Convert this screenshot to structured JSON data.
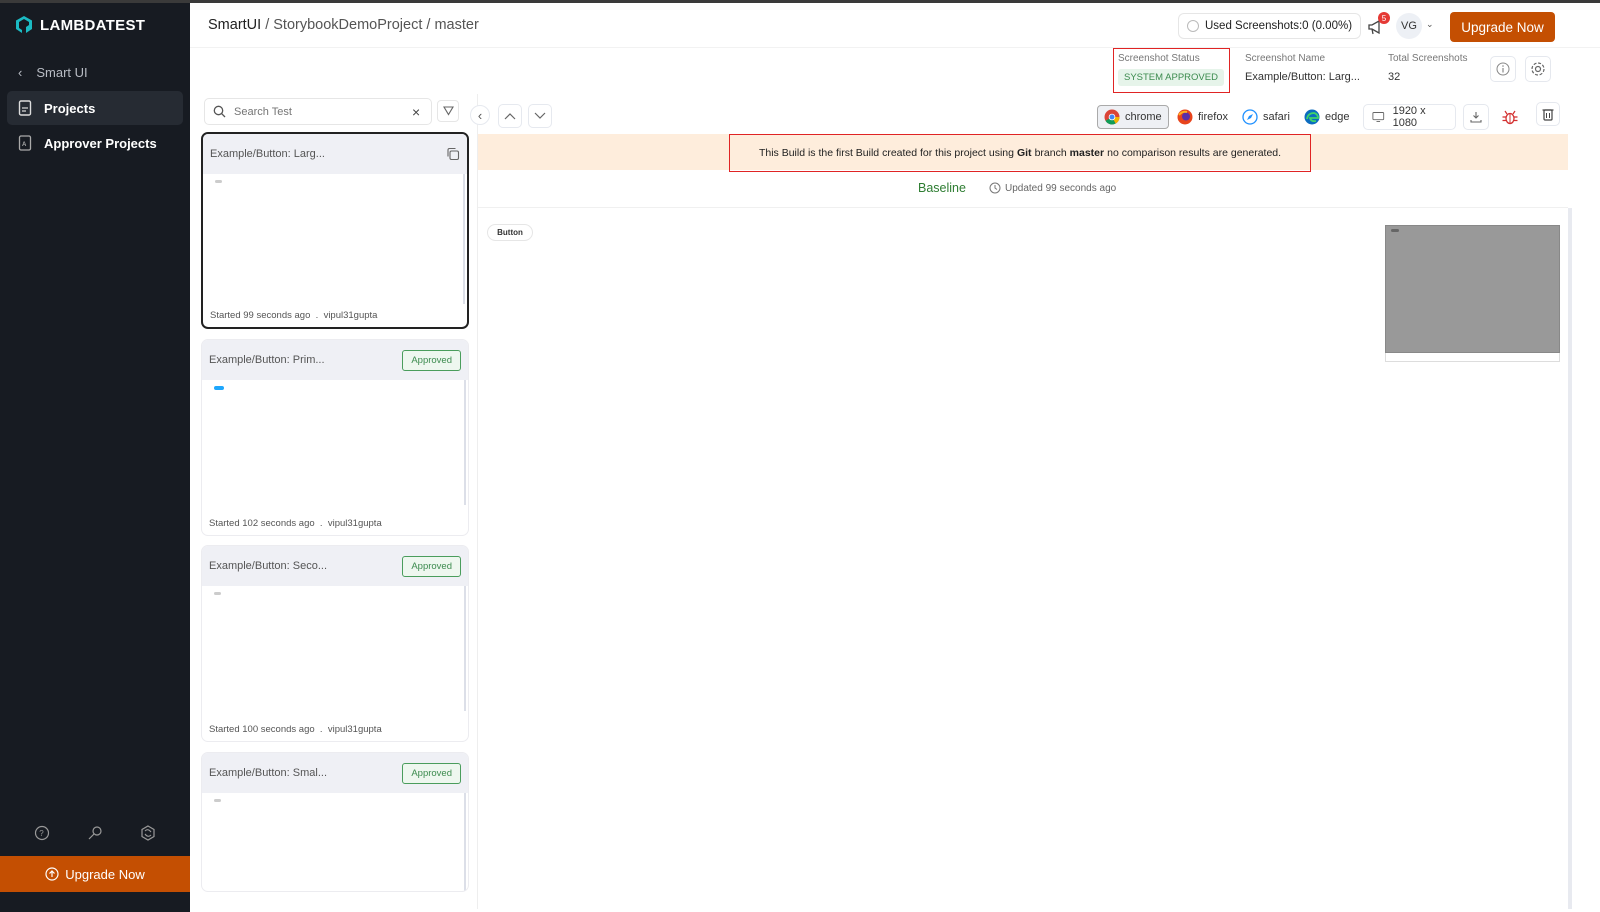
{
  "sidebar": {
    "brand": "LAMBDATEST",
    "back_label": "Smart UI",
    "items": [
      {
        "label": "Projects",
        "active": true
      },
      {
        "label": "Approver Projects",
        "active": false
      }
    ],
    "bottom_icons": [
      "help-icon",
      "key-icon",
      "integrations-icon"
    ],
    "upgrade_label": "Upgrade Now"
  },
  "header": {
    "breadcrumb": {
      "root": "SmartUI",
      "project": "StorybookDemoProject",
      "branch": "master"
    },
    "used_screenshots": "Used Screenshots:0 (0.00%)",
    "notification_count": "5",
    "avatar_initials": "VG",
    "upgrade_label": "Upgrade Now"
  },
  "infobar": {
    "status_label": "Screenshot Status",
    "status_value": "SYSTEM APPROVED",
    "name_label": "Screenshot Name",
    "name_value": "Example/Button: Larg...",
    "total_label": "Total Screenshots",
    "total_value": "32"
  },
  "search": {
    "placeholder": "Search Test",
    "value": ""
  },
  "cards": [
    {
      "title": "Example/Button: Larg...",
      "status": "",
      "started": "Started 99 seconds ago",
      "user": "vipul31gupta",
      "selected": true
    },
    {
      "title": "Example/Button: Prim...",
      "status": "Approved",
      "started": "Started 102 seconds ago",
      "user": "vipul31gupta",
      "selected": false
    },
    {
      "title": "Example/Button: Seco...",
      "status": "Approved",
      "started": "Started 100 seconds ago",
      "user": "vipul31gupta",
      "selected": false
    },
    {
      "title": "Example/Button: Smal...",
      "status": "Approved",
      "started": "",
      "user": "",
      "selected": false
    }
  ],
  "toolbar": {
    "browsers": [
      {
        "name": "chrome",
        "active": true
      },
      {
        "name": "firefox",
        "active": false
      },
      {
        "name": "safari",
        "active": false
      },
      {
        "name": "edge",
        "active": false
      }
    ],
    "resolution": "1920 x 1080"
  },
  "banner": {
    "prefix": "This Build is the first Build created for this project using ",
    "git": "Git",
    "middle": " branch ",
    "branch": "master",
    "suffix": " no comparison results are generated."
  },
  "baseline": {
    "label": "Baseline",
    "updated": "Updated 99 seconds ago"
  },
  "preview": {
    "button_label": "Button"
  },
  "colors": {
    "accent": "#c44f02",
    "approved": "#3c8b4e",
    "sidebar": "#171b22",
    "banner": "#feeddc",
    "highlight": "#e02424"
  }
}
